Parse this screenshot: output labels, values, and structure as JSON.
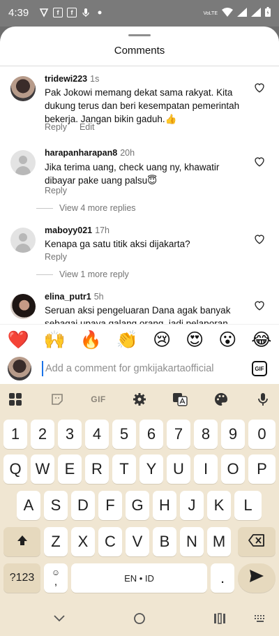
{
  "status_bar": {
    "time": "4:39",
    "network_label": "VoLTE"
  },
  "sheet": {
    "title": "Comments"
  },
  "comments": [
    {
      "user": "tridewi223",
      "time": "1s",
      "text": "Pak Jokowi memang dekat sama rakyat. Kita dukung terus dan beri kesempatan pemerintah bekerja. Jangan bikin gaduh.👍",
      "reply": "Reply",
      "edit": "Edit"
    },
    {
      "user": "harapanharapan8",
      "time": "20h",
      "text": "Jika terima uang, check uang ny, khawatir dibayar pake uang palsu😇",
      "reply": "Reply",
      "view_replies": "View 4 more replies"
    },
    {
      "user": "maboyy021",
      "time": "17h",
      "text": "Kenapa ga satu titik aksi dijakarta?",
      "reply": "Reply",
      "view_replies": "View 1 more reply"
    },
    {
      "user": "elina_putr1",
      "time": "5h",
      "text": "Seruan aksi pengeluaran Dana agak banyak sebagai upaya galang orang, jadi pelaporan"
    }
  ],
  "emoji_bar": [
    "❤️",
    "🙌",
    "🔥",
    "👏",
    "😢",
    "😍",
    "😮",
    "😂"
  ],
  "comment_input": {
    "placeholder": "Add a comment for gmkijakartaofficial",
    "gif_label": "GIF"
  },
  "keyboard": {
    "toolbar": {
      "gif_label": "GIF"
    },
    "number_row": [
      "1",
      "2",
      "3",
      "4",
      "5",
      "6",
      "7",
      "8",
      "9",
      "0"
    ],
    "row1": [
      "Q",
      "W",
      "E",
      "R",
      "T",
      "Y",
      "U",
      "I",
      "O",
      "P"
    ],
    "row2": [
      "A",
      "S",
      "D",
      "F",
      "G",
      "H",
      "J",
      "K",
      "L"
    ],
    "row3": [
      "Z",
      "X",
      "C",
      "V",
      "B",
      "N",
      "M"
    ],
    "symbols_label": "?123",
    "emoji_key": "☺",
    "comma_label": ",",
    "space_label": "EN • ID",
    "period_label": "."
  }
}
